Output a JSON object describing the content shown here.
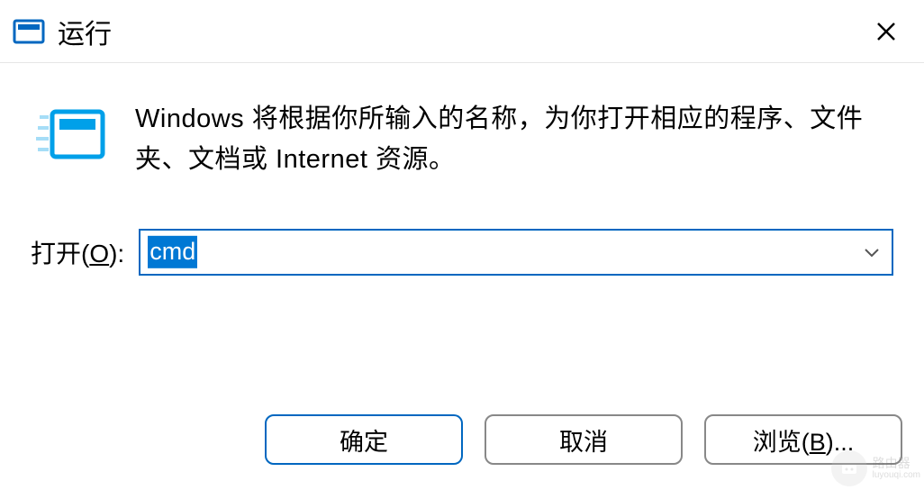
{
  "titlebar": {
    "title": "运行"
  },
  "content": {
    "description": "Windows 将根据你所输入的名称，为你打开相应的程序、文件夹、文档或 Internet 资源。",
    "open_label_prefix": "打开(",
    "open_label_hotkey": "O",
    "open_label_suffix": "):",
    "input_value": "cmd"
  },
  "buttons": {
    "ok": "确定",
    "cancel": "取消",
    "browse_prefix": "浏览(",
    "browse_hotkey": "B",
    "browse_suffix": ")..."
  },
  "watermark": {
    "line1": "路由器",
    "line2": "luyouqi.com"
  }
}
